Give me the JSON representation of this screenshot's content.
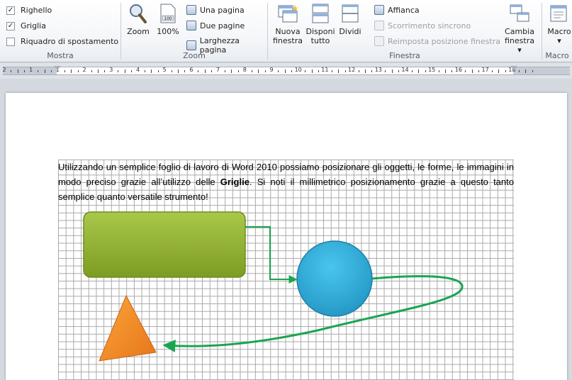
{
  "ribbon": {
    "mostra": {
      "label": "Mostra",
      "items": [
        {
          "label": "Righello",
          "checked": true
        },
        {
          "label": "Griglia",
          "checked": true
        },
        {
          "label": "Riquadro di spostamento",
          "checked": false
        }
      ]
    },
    "zoom": {
      "label": "Zoom",
      "zoom_button": "Zoom",
      "percent_button": "100%",
      "percent_icon_text": "100",
      "una_pagina": "Una pagina",
      "due_pagine": "Due pagine",
      "larghezza_pagina": "Larghezza pagina"
    },
    "finestra": {
      "label": "Finestra",
      "nuova_line1": "Nuova",
      "nuova_line2": "finestra",
      "disponi_line1": "Disponi",
      "disponi_line2": "tutto",
      "dividi": "Dividi",
      "affianca": "Affianca",
      "scorrimento": "Scorrimento sincrono",
      "reimposta": "Reimposta posizione finestra",
      "cambia_line1": "Cambia",
      "cambia_line2": "finestra ▾"
    },
    "macro": {
      "label": "Macro",
      "button_line1": "Macro",
      "button_line2": "▾"
    }
  },
  "ruler": {
    "labels": [
      "2",
      "1",
      "1",
      "2",
      "3",
      "4",
      "5",
      "6",
      "7",
      "8",
      "9",
      "10",
      "11",
      "12",
      "13",
      "14",
      "15",
      "16",
      "17",
      "18"
    ]
  },
  "document": {
    "text_part1": "Utilizzando un semplice foglio di lavoro di Word 2010 possiamo posizionare gli oggetti, le forme, le immagini in modo preciso grazie all’utilizzo delle ",
    "text_bold": "Griglie",
    "text_part2": ". Si noti il millimetrico posizionamento  grazie a questo tanto semplice quanto versatile strumento!"
  },
  "colors": {
    "rect": "#8fb030",
    "circle": "#35aedb",
    "triangle": "#f08a20",
    "connector": "#1aa550"
  }
}
